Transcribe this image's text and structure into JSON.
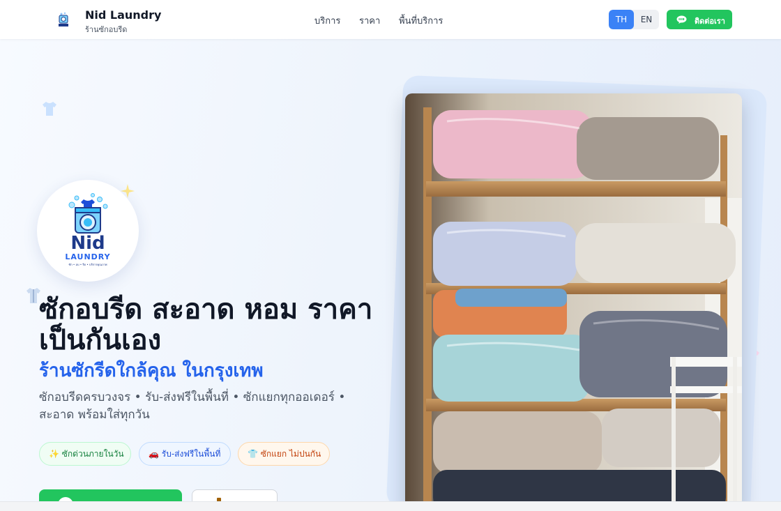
{
  "brand": {
    "name": "Nid Laundry",
    "subtitle": "ร้านซักอบรีด",
    "logo_icon": "washing-machine-logo-icon"
  },
  "nav": {
    "links": [
      {
        "label": "บริการ"
      },
      {
        "label": "ราคา"
      },
      {
        "label": "พื้นที่บริการ"
      }
    ],
    "languages": [
      "TH",
      "EN"
    ],
    "active_language": "TH",
    "contact_label": "ติดต่อเรา",
    "contact_icon": "line-chat-icon"
  },
  "hero": {
    "logo": {
      "word": "Nid",
      "word2": "LAUNDRY",
      "tagline": "ซัก • อบ • รีด • บริการคุณภาพ"
    },
    "title": "ซักอบรีด สะอาด หอม ราคาเป็นกันเอง",
    "subtitle": "ร้านซักรีดใกล้คุณ ในกรุงเทพ",
    "description": "ซักอบรีดครบวงจร • รับ-ส่งฟรีในพื้นที่ • ซักแยกทุกออเดอร์ • สะอาด พร้อมใส่ทุกวัน",
    "chips": [
      {
        "label": "✨ ซักด่วนภายในวัน"
      },
      {
        "label": "🚗 รับ-ส่งฟรีในพื้นที่"
      },
      {
        "label": "👕 ซักแยก ไม่ปนกัน"
      }
    ]
  },
  "colors": {
    "accent_blue": "#3b82f6",
    "cta_green": "#22c55e",
    "title_dark": "#111827",
    "subtitle_blue": "#2563eb"
  }
}
